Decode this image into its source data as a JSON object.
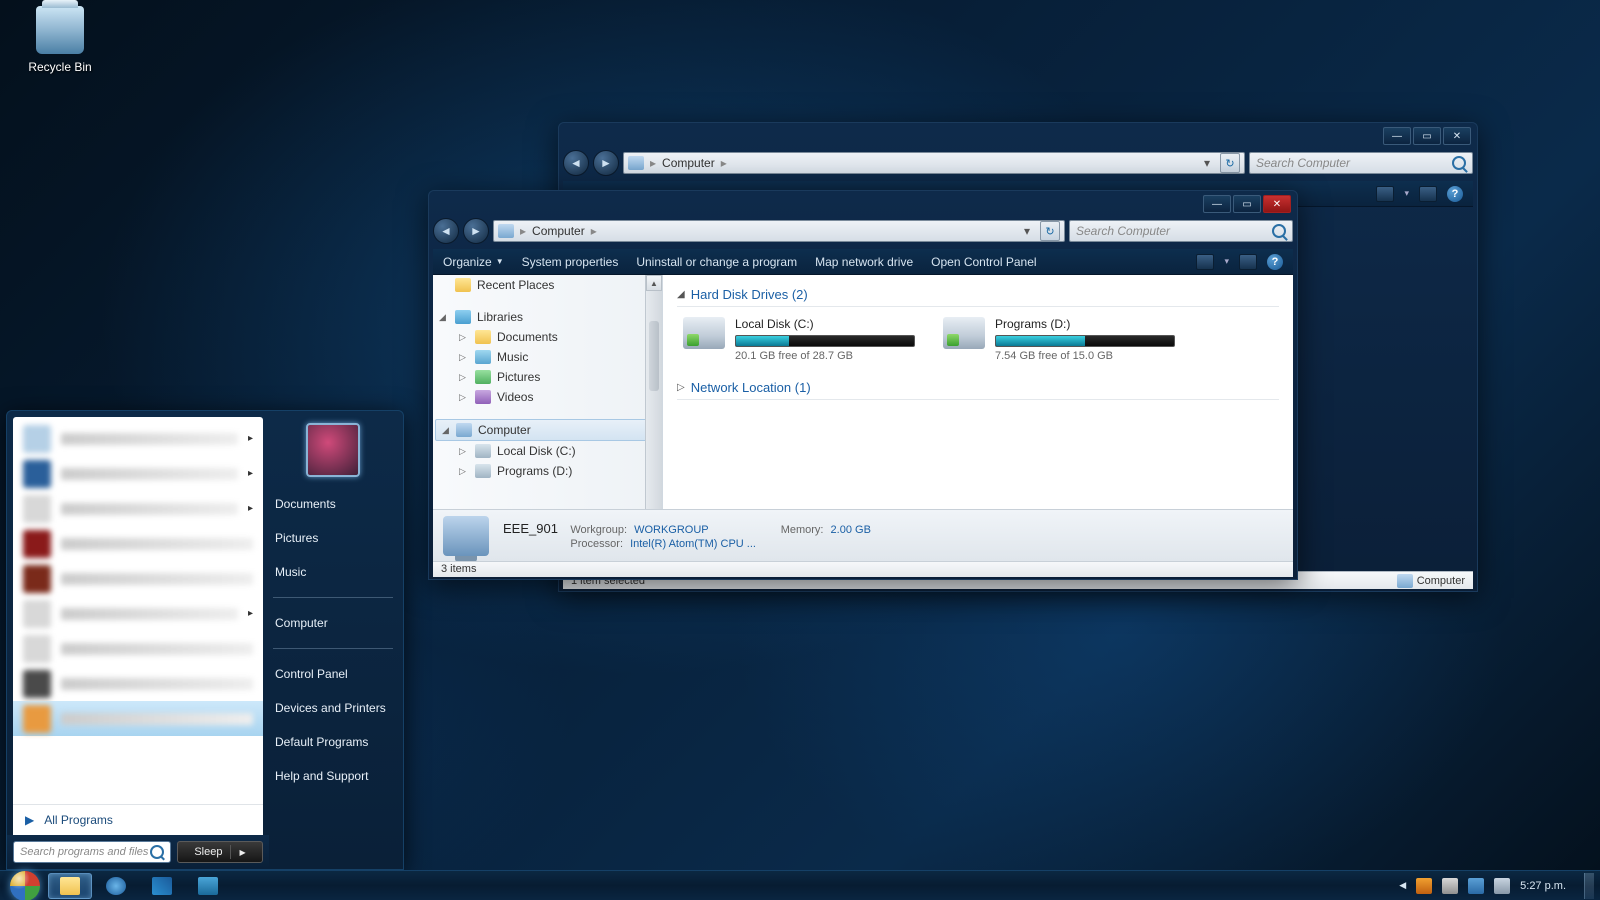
{
  "desktop": {
    "recycle_bin": "Recycle Bin"
  },
  "back_win": {
    "breadcrumb": "Computer",
    "search_placeholder": "Search Computer",
    "status_selected": "1 item selected",
    "status_location": "Computer"
  },
  "front_win": {
    "breadcrumb": "Computer",
    "search_placeholder": "Search Computer",
    "toolbar": {
      "organize": "Organize",
      "sysprops": "System properties",
      "uninstall": "Uninstall or change a program",
      "mapdrive": "Map network drive",
      "controlpanel": "Open Control Panel"
    },
    "nav": {
      "recent": "Recent Places",
      "libraries": "Libraries",
      "documents": "Documents",
      "music": "Music",
      "pictures": "Pictures",
      "videos": "Videos",
      "computer": "Computer",
      "local_c": "Local Disk (C:)",
      "programs_d": "Programs (D:)"
    },
    "groups": {
      "hdd": "Hard Disk Drives (2)",
      "network": "Network Location (1)"
    },
    "drives": {
      "c": {
        "name": "Local Disk (C:)",
        "free": "20.1 GB free of 28.7 GB"
      },
      "d": {
        "name": "Programs (D:)",
        "free": "7.54 GB free of 15.0 GB"
      }
    },
    "details": {
      "name": "EEE_901",
      "workgroup_label": "Workgroup:",
      "workgroup": "WORKGROUP",
      "processor_label": "Processor:",
      "processor": "Intel(R) Atom(TM) CPU ...",
      "memory_label": "Memory:",
      "memory": "2.00 GB"
    },
    "status": "3 items"
  },
  "start_menu": {
    "all_programs": "All Programs",
    "search_placeholder": "Search programs and files",
    "sleep": "Sleep",
    "links": {
      "documents": "Documents",
      "pictures": "Pictures",
      "music": "Music",
      "computer": "Computer",
      "control_panel": "Control Panel",
      "devices": "Devices and Printers",
      "default_programs": "Default Programs",
      "help": "Help and Support"
    }
  },
  "taskbar": {
    "clock": "5:27 p.m."
  }
}
